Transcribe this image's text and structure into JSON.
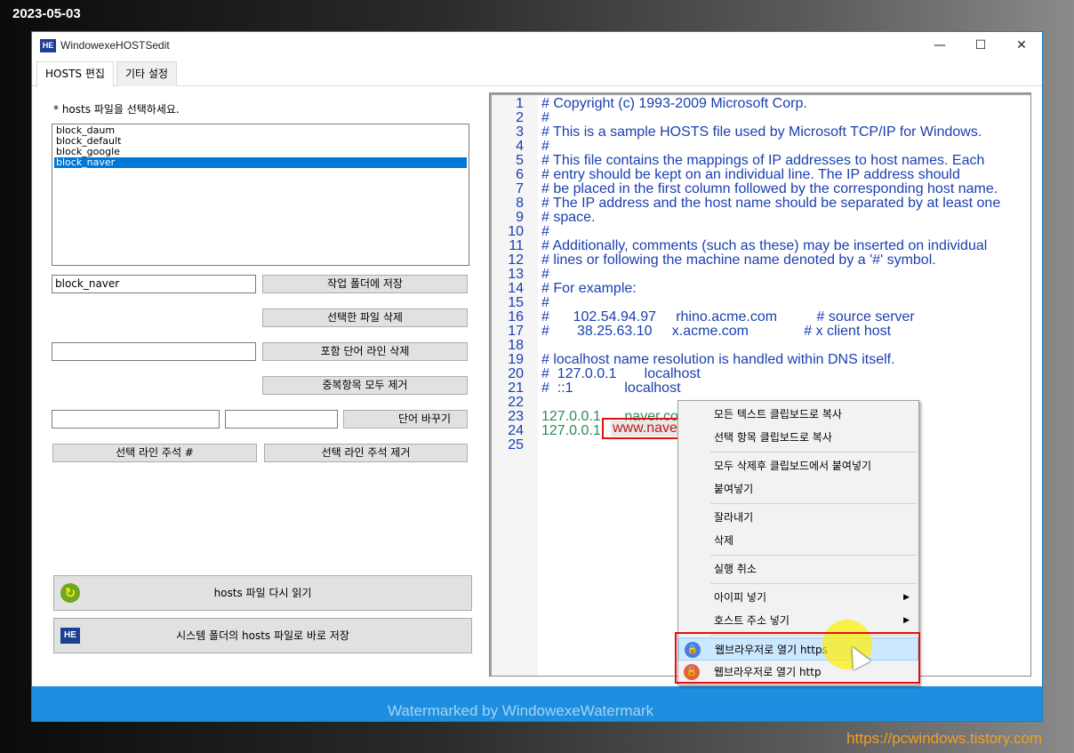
{
  "overlay": {
    "date": "2023-05-03",
    "blog_url": "https://pcwindows.tistory.com"
  },
  "window": {
    "icon_text": "HE",
    "title": "WindowexeHOSTSedit",
    "controls": {
      "minimize": "—",
      "maximize": "☐",
      "close": "✕"
    }
  },
  "tabs": [
    {
      "label": "HOSTS 편집",
      "active": true
    },
    {
      "label": "기타 설정",
      "active": false
    }
  ],
  "left_pane": {
    "hint": "* hosts 파일을 선택하세요.",
    "files": [
      "block_daum",
      "block_default",
      "block_google",
      "block_naver"
    ],
    "selected_file": "block_naver",
    "filename_value": "block_naver",
    "buttons": {
      "save_to_workfolder": "작업 폴더에 저장",
      "delete_selected_file": "선택한 파일 삭제",
      "delete_lines_with_word": "포함 단어 라인 삭제",
      "remove_duplicates": "중복항목 모두 제거",
      "replace_word": "단어 바꾸기",
      "comment_lines": "선택 라인 주석 #",
      "uncomment_lines": "선택 라인 주석 제거",
      "reload_hosts": "hosts 파일 다시 읽기",
      "save_to_system": "시스템 폴더의 hosts 파일로 바로 저장"
    },
    "icons": {
      "reload": "reload-icon",
      "he": "HE"
    }
  },
  "editor": {
    "lines": [
      {
        "n": "1",
        "text": "# Copyright (c) 1993-2009 Microsoft Corp.",
        "color": "#1a3fb0"
      },
      {
        "n": "2",
        "text": "#",
        "color": "#1a3fb0"
      },
      {
        "n": "3",
        "text": "# This is a sample HOSTS file used by Microsoft TCP/IP for Windows.",
        "color": "#1a3fb0"
      },
      {
        "n": "4",
        "text": "#",
        "color": "#1a3fb0"
      },
      {
        "n": "5",
        "text": "# This file contains the mappings of IP addresses to host names. Each",
        "color": "#1a3fb0"
      },
      {
        "n": "6",
        "text": "# entry should be kept on an individual line. The IP address should",
        "color": "#1a3fb0"
      },
      {
        "n": "7",
        "text": "# be placed in the first column followed by the corresponding host name.",
        "color": "#1a3fb0"
      },
      {
        "n": "8",
        "text": "# The IP address and the host name should be separated by at least one",
        "color": "#1a3fb0"
      },
      {
        "n": "9",
        "text": "# space.",
        "color": "#1a3fb0"
      },
      {
        "n": "10",
        "text": "#",
        "color": "#1a3fb0"
      },
      {
        "n": "11",
        "text": "# Additionally, comments (such as these) may be inserted on individual",
        "color": "#1a3fb0"
      },
      {
        "n": "12",
        "text": "# lines or following the machine name denoted by a '#' symbol.",
        "color": "#1a3fb0"
      },
      {
        "n": "13",
        "text": "#",
        "color": "#1a3fb0"
      },
      {
        "n": "14",
        "text": "# For example:",
        "color": "#1a3fb0"
      },
      {
        "n": "15",
        "text": "#",
        "color": "#1a3fb0"
      },
      {
        "n": "16",
        "text": "#      102.54.94.97     rhino.acme.com          # source server",
        "color": "#1a3fb0"
      },
      {
        "n": "17",
        "text": "#       38.25.63.10     x.acme.com              # x client host",
        "color": "#1a3fb0"
      },
      {
        "n": "18",
        "text": "",
        "color": "#1a3fb0"
      },
      {
        "n": "19",
        "text": "# localhost name resolution is handled within DNS itself.",
        "color": "#1a3fb0"
      },
      {
        "n": "20",
        "text": "#  127.0.0.1       localhost",
        "color": "#1a3fb0"
      },
      {
        "n": "21",
        "text": "#  ::1             localhost",
        "color": "#1a3fb0"
      },
      {
        "n": "22",
        "text": "",
        "color": "#1a3fb0"
      },
      {
        "n": "23",
        "text": "127.0.0.1      naver.com",
        "color": "#2e8b57"
      },
      {
        "n": "24",
        "text": "127.0.0.1",
        "color": "#2e8b57"
      },
      {
        "n": "25",
        "text": "",
        "color": "#1a3fb0"
      }
    ],
    "selected_url": "www.naver.com"
  },
  "context_menu": {
    "items": [
      {
        "label": "모든 텍스트 클립보드로 복사"
      },
      {
        "label": "선택 항목 클립보드로 복사"
      },
      {
        "label": "모두 삭제후 클립보드에서 붙여넣기"
      },
      {
        "label": "붙여넣기"
      },
      {
        "label": "잘라내기"
      },
      {
        "label": "삭제"
      },
      {
        "label": "실행 취소"
      },
      {
        "label": "아이피 넣기",
        "submenu": true
      },
      {
        "label": "호스트 주소 넣기",
        "submenu": true
      },
      {
        "label": "웹브라우저로 열기 https",
        "icon": "lock-icon",
        "icon_color": "#4a7be0"
      },
      {
        "label": "웹브라우저로 열기 http",
        "icon": "unlock-icon",
        "icon_color": "#e8603a"
      }
    ]
  },
  "status": {
    "watermark": "Watermarked by WindowexeWatermark"
  }
}
